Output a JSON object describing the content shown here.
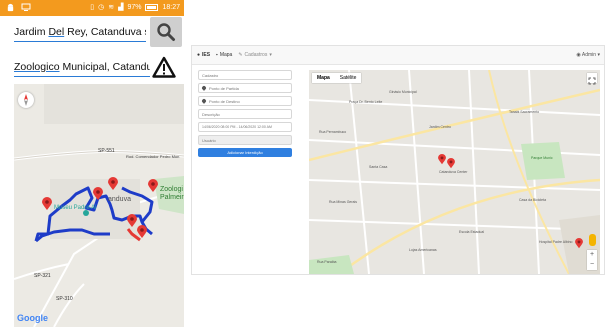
{
  "phone": {
    "status_bar": {
      "battery_percent": "97%",
      "time": "18:27"
    },
    "origin_field": {
      "value_prefix": "Jardim ",
      "value_underlined": "Del",
      "value_suffix": " Rey, Catanduva sp"
    },
    "destination_field": {
      "value_underlined": "Zoologico",
      "value_suffix": " Municipal, Catanduv"
    },
    "map": {
      "labels": {
        "sp551": "SP-551",
        "comendador": "Rod. Comendador Pedro Mon",
        "zoologi": "Zoologi",
        "palmeir": "Palmeir",
        "museu": "Museu Padre Al",
        "catanduva": "anduva",
        "sp321": "SP-321",
        "sp310": "SP-310"
      },
      "google_logo": "Google"
    }
  },
  "web": {
    "navbar": {
      "brand": "IES",
      "nav_mapa": "Mapa",
      "nav_cadastros": "Cadastros",
      "user": "Admin"
    },
    "form": {
      "title_placeholder": "Cadastro",
      "origin_placeholder": "Ponto de Partida",
      "destination_placeholder": "Ponto de Destino",
      "description_placeholder": "Descrição",
      "datetime_value": "14/06/2020 08:00 PM - 14/06/2020 12:00 AM",
      "user_placeholder": "Usuário",
      "submit_label": "Adicionar Interdição"
    },
    "map": {
      "tab_map": "Mapa",
      "tab_satellite": "Satélite",
      "labels": {
        "l1": "Praça Dr. Bento Leite",
        "l2": "Ginásio Municipal",
        "l3": "Rua Pernambuco",
        "l4": "Jardim Centro",
        "l5": "Tanabi Sacramento",
        "l6": "Santa Casa",
        "l7": "Parque Munic",
        "l8": "Catanduva Center",
        "l9": "Casa da Bicicleta",
        "l10": "Rua Minas Gerais",
        "l11": "Escola Estadual",
        "l12": "Hospital Padre Albino",
        "l13": "Lojas Americanas",
        "l14": "Rua Paraiba"
      }
    }
  },
  "colors": {
    "status_bar": "#f39a1e",
    "route": "#1e3cc8",
    "marker": "#e53935",
    "underline": "#2a7bd6",
    "submit_button": "#2f7fe0"
  }
}
